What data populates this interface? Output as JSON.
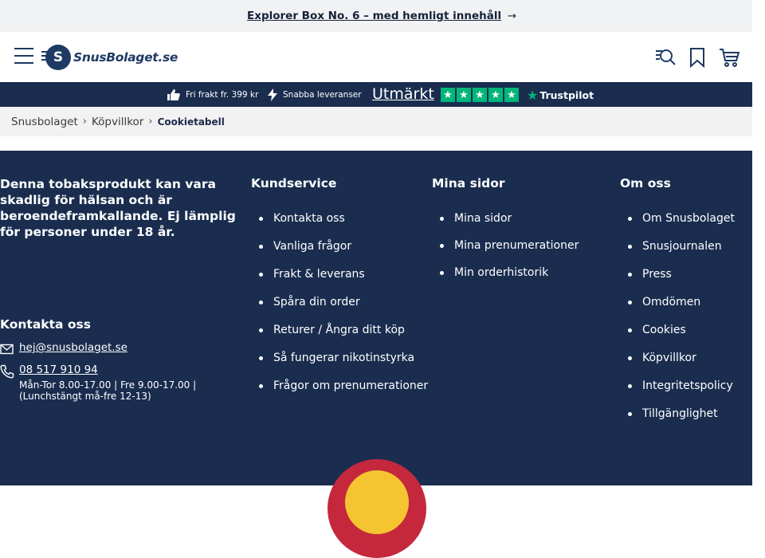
{
  "promo": {
    "text": "Explorer Box No. 6 – med hemligt innehåll",
    "arrow": "→"
  },
  "header": {
    "brand": "SnusBolaget.se",
    "logo_letter": "S",
    "icons": [
      "menu-icon",
      "search-icon",
      "bookmark-icon",
      "cart-icon"
    ]
  },
  "usp": {
    "items": [
      "Fri frakt fr. 399 kr",
      "Snabba leveranser"
    ],
    "trustpilot_rating_word": "Utmärkt",
    "trustpilot_brand": "Trustpilot",
    "stars": 5
  },
  "breadcrumb": {
    "items": [
      "Snusbolaget",
      "Köpvillkor"
    ],
    "current": "Cookietabell"
  },
  "footer": {
    "warning": "Denna tobaksprodukt kan vara skadlig för hälsan och är beroendeframkallande. Ej lämplig för personer under 18 år.",
    "contact": {
      "title": "Kontakta oss",
      "email": "hej@snusbolaget.se",
      "phone": "08 517 910 94",
      "hours": "Mån-Tor 8.00-17.00 | Fre 9.00-17.00 | (Lunchstängt må-fre 12-13)"
    },
    "columns": [
      {
        "title": "Kundservice",
        "items": [
          "Kontakta oss",
          "Vanliga frågor",
          "Frakt & leverans",
          "Spåra din order",
          "Returer / Ångra ditt köp",
          "Så fungerar nikotinstyrka",
          "Frågor om prenumerationer"
        ]
      },
      {
        "title": "Mina sidor",
        "items": [
          "Mina sidor",
          "Mina prenumerationer",
          "Min orderhistorik"
        ]
      },
      {
        "title": "Om oss",
        "items": [
          "Om Snusbolaget",
          "Snusjournalen",
          "Press",
          "Omdömen",
          "Cookies",
          "Köpvillkor",
          "Integritetspolicy",
          "Tillgänglighet"
        ]
      }
    ]
  },
  "colors": {
    "navy": "#1a2d4f",
    "trustpilot_green": "#00b67a",
    "badge_red": "#c5283d",
    "badge_yellow": "#f4c531"
  }
}
